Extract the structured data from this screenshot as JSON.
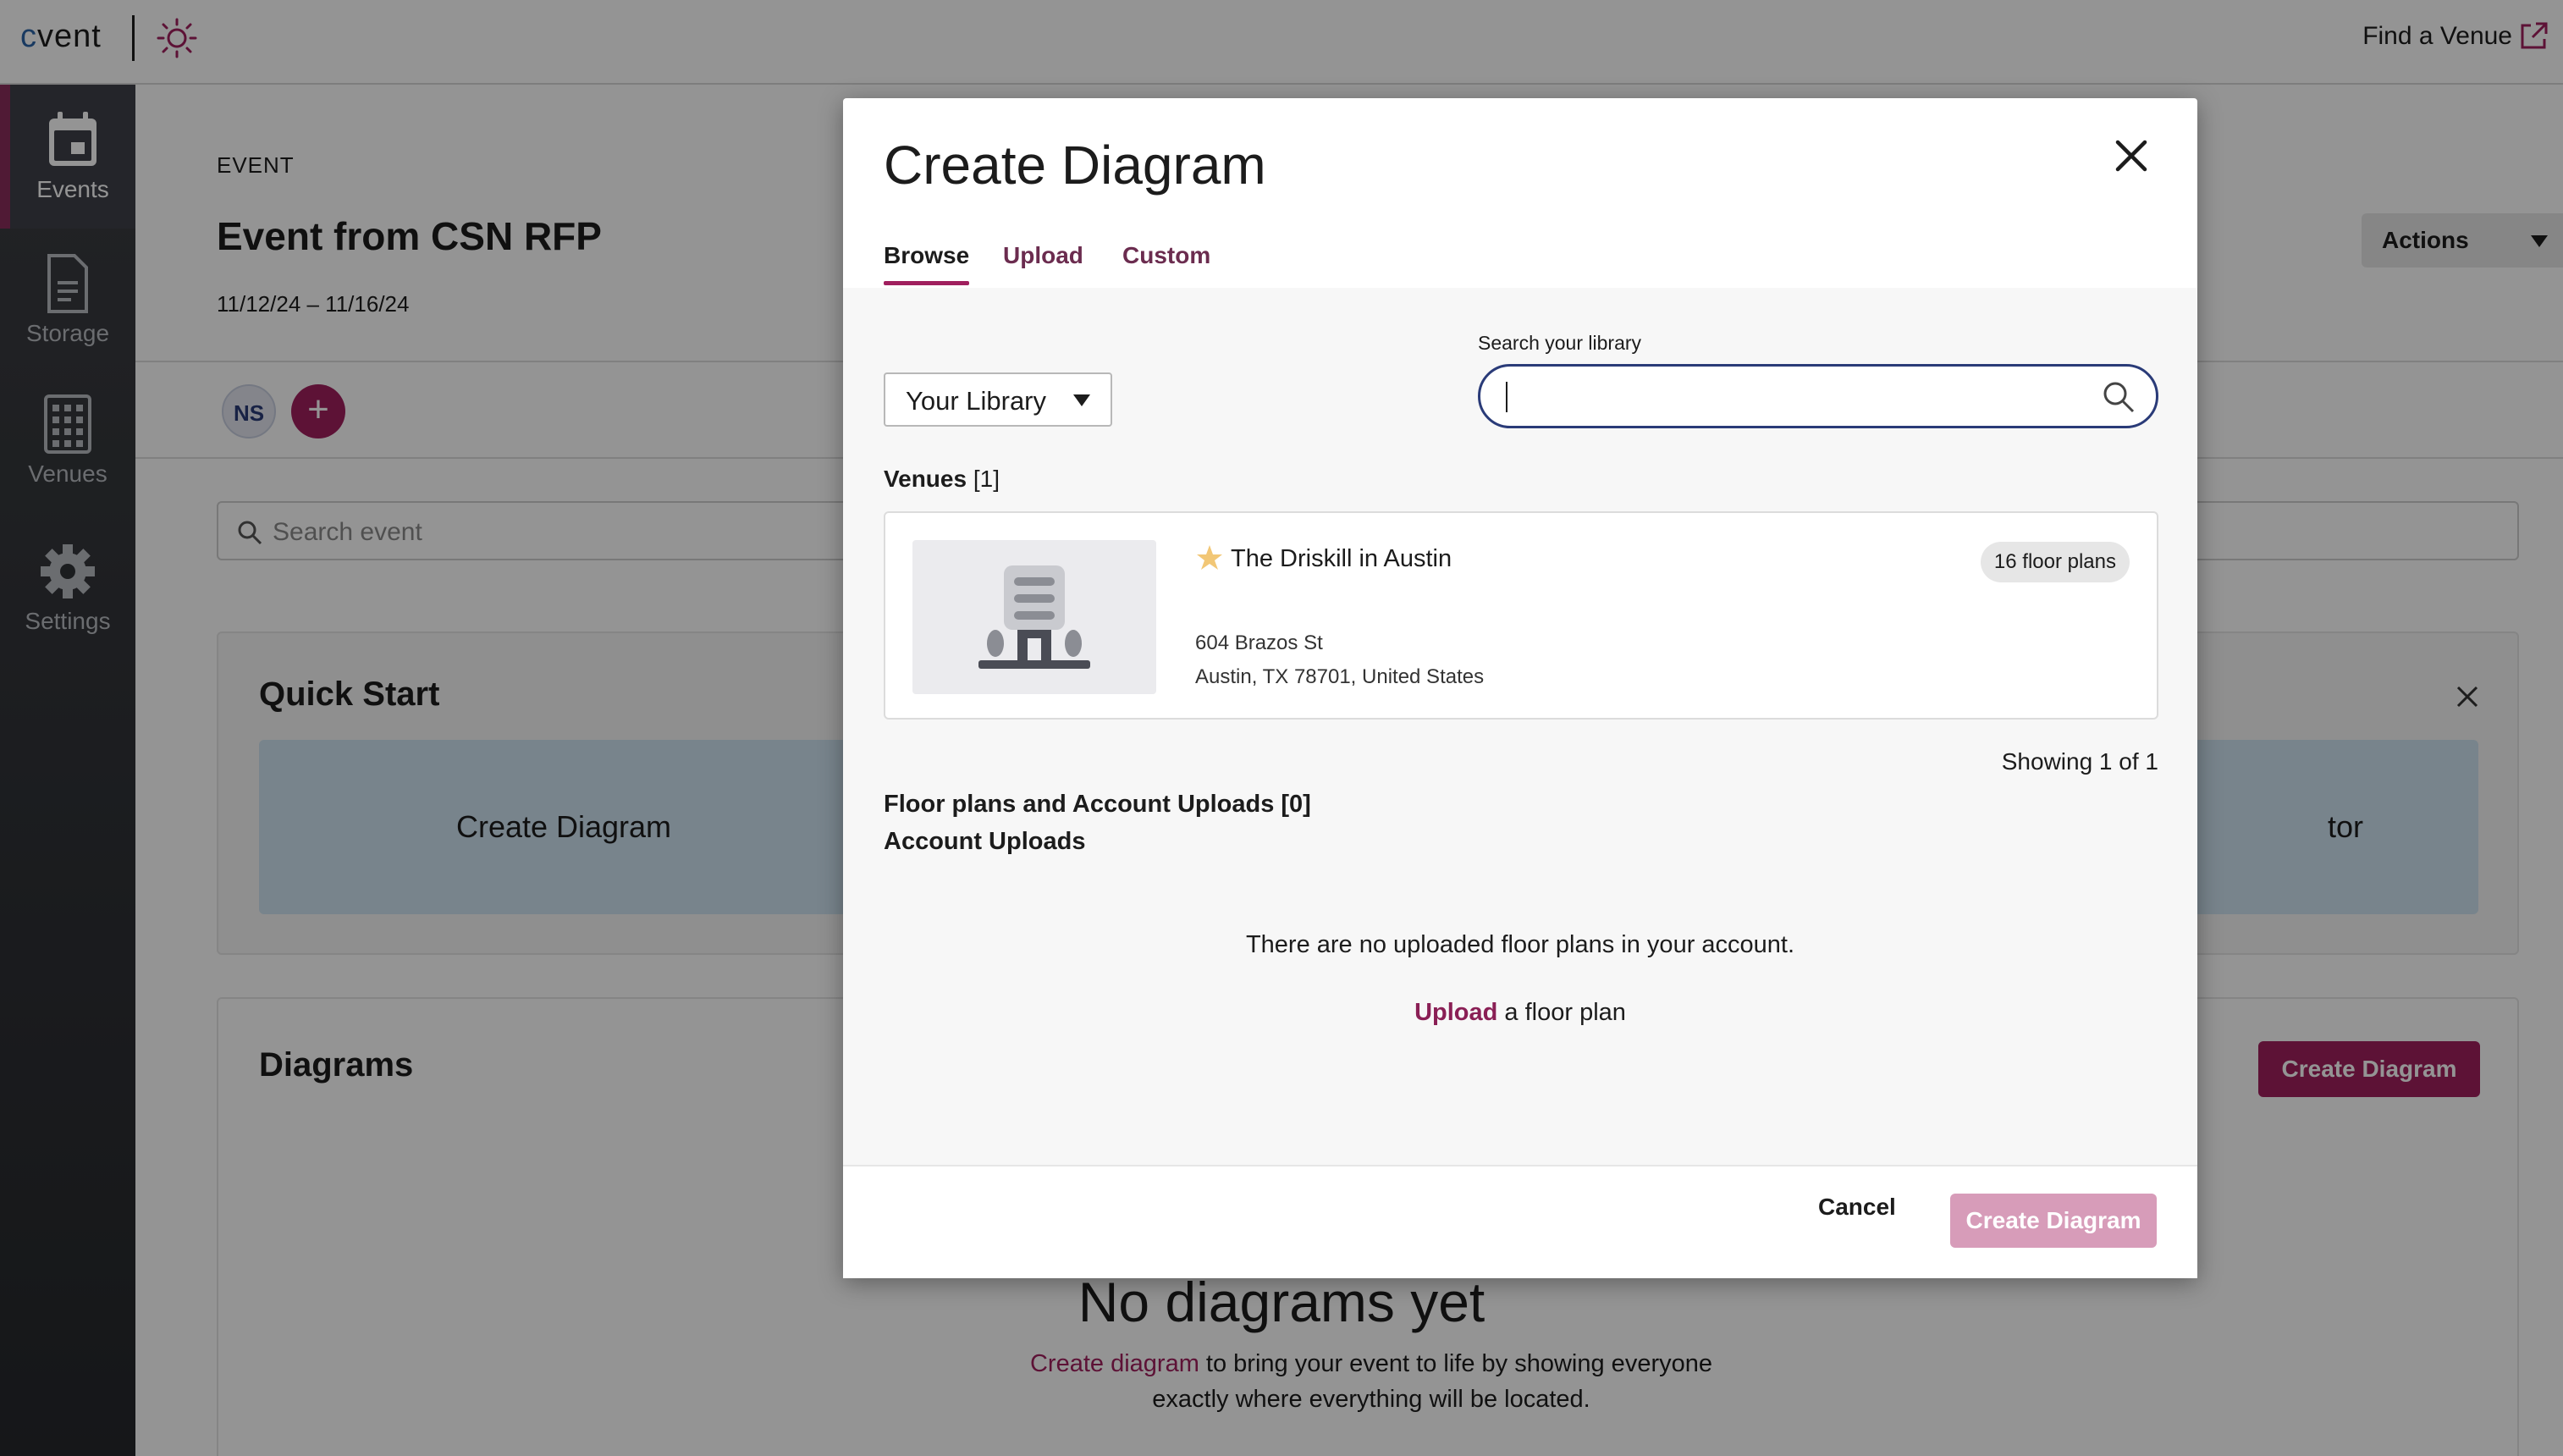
{
  "topbar": {
    "logo_prefix": "c",
    "logo_rest": "vent",
    "find_venue": "Find a Venue"
  },
  "sidebar": {
    "items": [
      {
        "label": "Events",
        "icon": "calendar-icon",
        "active": true
      },
      {
        "label": "Storage",
        "icon": "document-icon",
        "active": false
      },
      {
        "label": "Venues",
        "icon": "building-icon",
        "active": false
      },
      {
        "label": "Settings",
        "icon": "gear-icon",
        "active": false
      }
    ]
  },
  "event": {
    "eyebrow": "EVENT",
    "title": "Event from CSN RFP",
    "dates": "11/12/24 – 11/16/24",
    "actions_label": "Actions",
    "avatar_initials": "NS",
    "add_label": "+",
    "search_placeholder": "Search event"
  },
  "quick_start": {
    "title": "Quick Start",
    "tile1": "Create Diagram",
    "tile2_partial": "tor"
  },
  "diagrams": {
    "title": "Diagrams",
    "create_button": "Create Diagram",
    "empty_title": "No diagrams yet",
    "empty_link": "Create diagram",
    "empty_text": " to bring your event to life by showing everyone exactly where everything will be located."
  },
  "modal": {
    "title": "Create Diagram",
    "tabs": [
      {
        "label": "Browse",
        "active": true
      },
      {
        "label": "Upload",
        "active": false
      },
      {
        "label": "Custom",
        "active": false
      }
    ],
    "library_select": "Your Library",
    "search_label": "Search your library",
    "search_value": "",
    "venues_label": "Venues",
    "venues_count": "[1]",
    "venue": {
      "name": "The Driskill in Austin",
      "badge": "16 floor plans",
      "address_line1": "604 Brazos St",
      "address_line2": "Austin, TX 78701, United States",
      "favorite": true
    },
    "showing": "Showing 1 of 1",
    "floorplans_header": "Floor plans and Account Uploads [0]",
    "account_uploads_header": "Account Uploads",
    "no_uploads": "There are no uploaded floor plans in your account.",
    "upload_link": "Upload",
    "upload_text": " a floor plan",
    "cancel": "Cancel",
    "create": "Create Diagram"
  },
  "colors": {
    "brand": "#a01f5e",
    "focus": "#2a3b78",
    "disabled_primary": "#d79cb9"
  }
}
